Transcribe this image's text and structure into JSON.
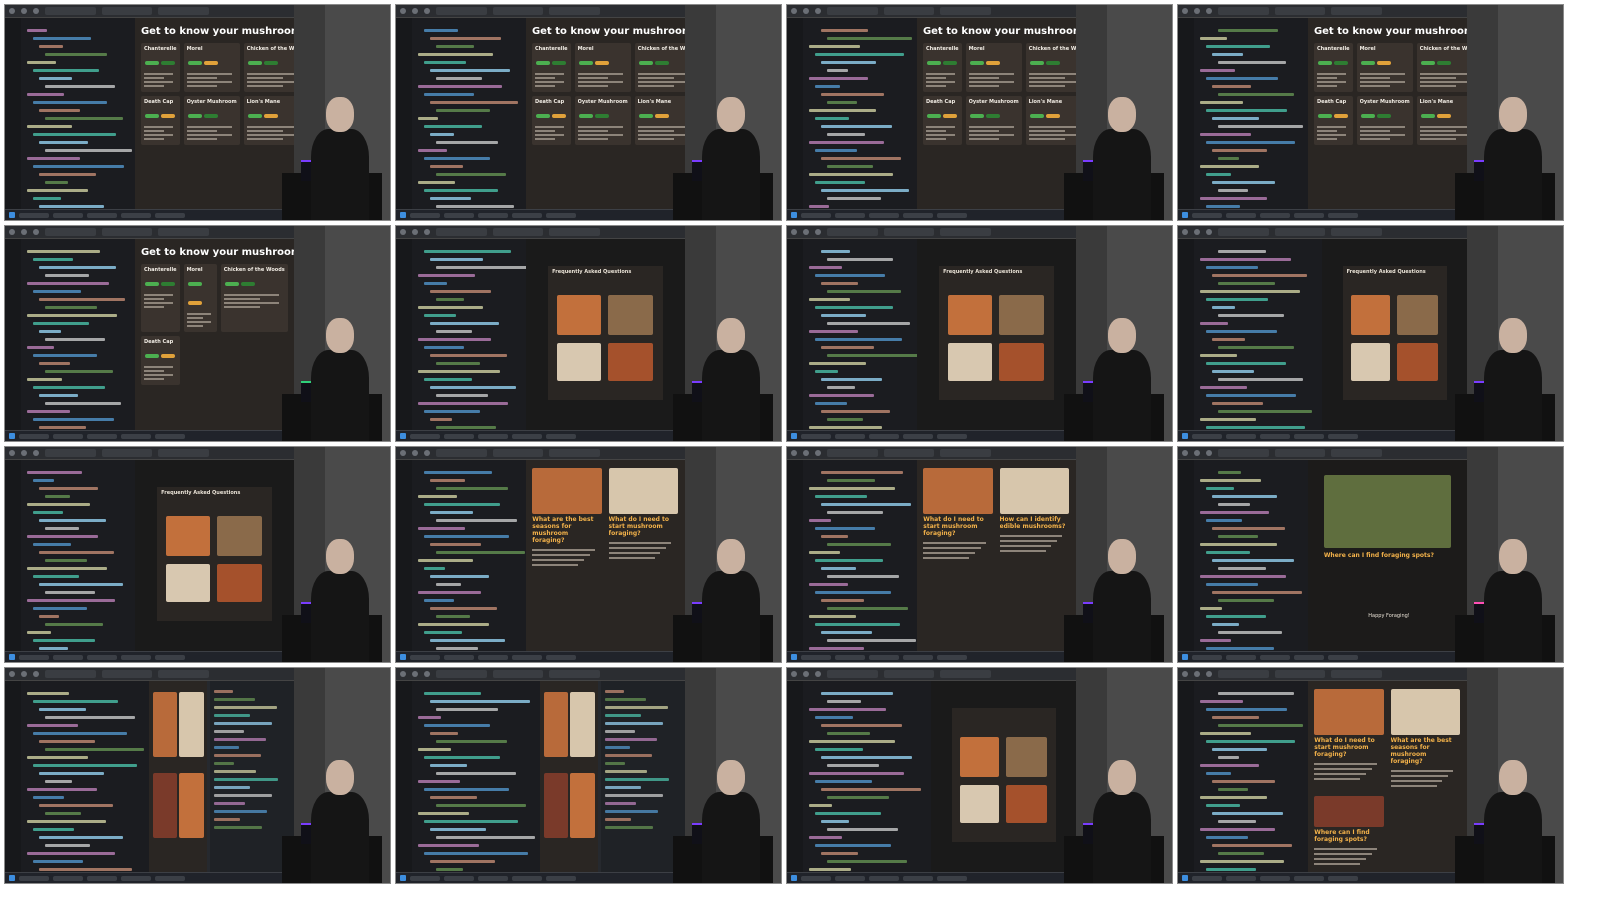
{
  "grid": {
    "columns": 4,
    "rows": 4
  },
  "colors": {
    "frame_border": "#8a8a8a",
    "screen_bg": "#1e1f22",
    "page_bg": "#2a2623",
    "card_bg": "#3a332e",
    "code_purple": "#c586c0",
    "code_blue": "#569cd6",
    "code_orange": "#ce9178",
    "code_green": "#6a9955",
    "code_yellow": "#dcdcaa",
    "code_cyan": "#4ec9b0"
  },
  "thumbnails": [
    {
      "kind": "mushrooms",
      "title": "Get to know your mushrooms",
      "cards": [
        "Chanterelle",
        "Morel",
        "Chicken of the Woods",
        "Death Cap",
        "Oyster Mushroom",
        "Lion's Mane"
      ],
      "laptop": "purple"
    },
    {
      "kind": "mushrooms",
      "title": "Get to know your mushrooms",
      "cards": [
        "Chanterelle",
        "Morel",
        "Chicken of the Woods",
        "Death Cap",
        "Oyster Mushroom",
        "Lion's Mane"
      ],
      "laptop": "purple"
    },
    {
      "kind": "mushrooms",
      "title": "Get to know your mushrooms",
      "cards": [
        "Chanterelle",
        "Morel",
        "Chicken of the Woods",
        "Death Cap",
        "Oyster Mushroom",
        "Lion's Mane"
      ],
      "laptop": "purple"
    },
    {
      "kind": "mushrooms",
      "title": "Get to know your mushrooms",
      "cards": [
        "Chanterelle",
        "Morel",
        "Chicken of the Woods",
        "Death Cap",
        "Oyster Mushroom",
        "Lion's Mane"
      ],
      "laptop": "purple"
    },
    {
      "kind": "mushrooms",
      "title": "Get to know your mushrooms",
      "cards": [
        "Chanterelle",
        "Morel",
        "Chicken of the Woods",
        "Death Cap"
      ],
      "laptop": "green"
    },
    {
      "kind": "faq",
      "title": "Frequently Asked Questions",
      "laptop": "purple"
    },
    {
      "kind": "faq",
      "title": "Frequently Asked Questions",
      "laptop": "purple"
    },
    {
      "kind": "faq-narrow",
      "title": "Frequently Asked Questions",
      "laptop": "purple"
    },
    {
      "kind": "faq",
      "title": "Frequently Asked Questions",
      "laptop": "purple"
    },
    {
      "kind": "article",
      "title": "What are the best seasons for mushroom foraging?",
      "title2": "What do I need to start mushroom foraging?",
      "laptop": "purple"
    },
    {
      "kind": "article",
      "title": "What do I need to start mushroom foraging?",
      "title2": "How can I identify edible mushrooms?",
      "laptop": "purple"
    },
    {
      "kind": "single",
      "title": "Where can I find foraging spots?",
      "footer": "Happy Foraging!",
      "laptop": "pink"
    },
    {
      "kind": "devtools",
      "title": "",
      "laptop": "purple"
    },
    {
      "kind": "devtools",
      "title": "",
      "laptop": "purple"
    },
    {
      "kind": "faq-narrow",
      "title": "",
      "laptop": "purple"
    },
    {
      "kind": "article",
      "title": "What do I need to start mushroom foraging?",
      "title2": "What are the best seasons for mushroom foraging?",
      "title3": "Where can I find foraging spots?",
      "laptop": "purple"
    }
  ]
}
